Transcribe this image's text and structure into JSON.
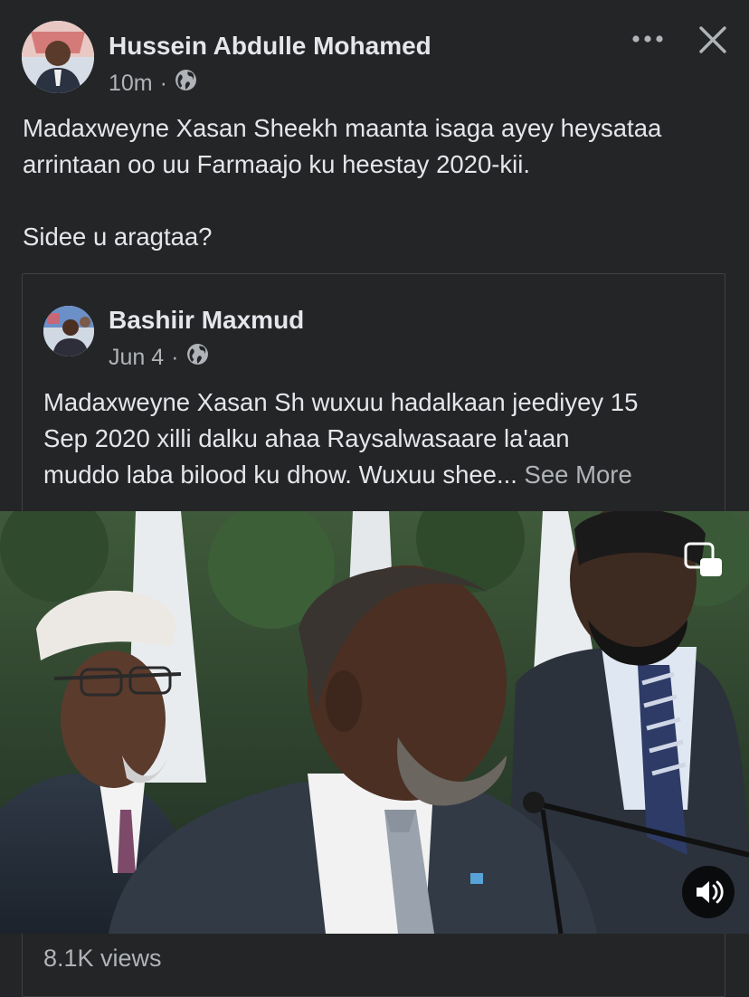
{
  "post": {
    "author": "Hussein Abdulle Mohamed",
    "time": "10m",
    "sep": "·",
    "audience_icon": "globe-icon",
    "text": "Madaxweyne Xasan Sheekh maanta isaga ayey heysataa\narrintaan oo uu Farmaajo ku heestay 2020-kii.\n\nSidee u aragtaa?",
    "more_icon": "more-icon",
    "close_icon": "close-icon"
  },
  "shared": {
    "author": "Bashiir Maxmud",
    "time": "Jun 4",
    "sep": "·",
    "audience_icon": "globe-icon",
    "text": "Madaxweyne Xasan Sh wuxuu hadalkaan jeediyey 15\nSep 2020 xilli dalku ahaa Raysalwasaare la'aan\nmuddo laba bilood ku dhow. Wuxuu shee... ",
    "see_more": "See More"
  },
  "video": {
    "pip_icon": "picture-in-picture-icon",
    "sound_icon": "sound-on-icon",
    "views": "8.1K views"
  },
  "colors": {
    "background": "#242526",
    "text": "#e4e6eb",
    "secondary": "#b0b3b8",
    "border": "#3e4042"
  }
}
